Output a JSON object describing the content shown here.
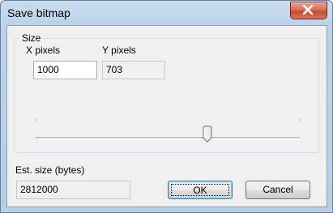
{
  "window": {
    "title": "Save bitmap",
    "close_icon": "close-x-icon"
  },
  "size_group": {
    "label": "Size",
    "x_label": "X pixels",
    "x_value": "1000",
    "y_label": "Y pixels",
    "y_value": "703",
    "slider_position": 0.65
  },
  "estimate": {
    "label": "Est. size (bytes)",
    "value": "2812000"
  },
  "buttons": {
    "ok": "OK",
    "cancel": "Cancel"
  }
}
